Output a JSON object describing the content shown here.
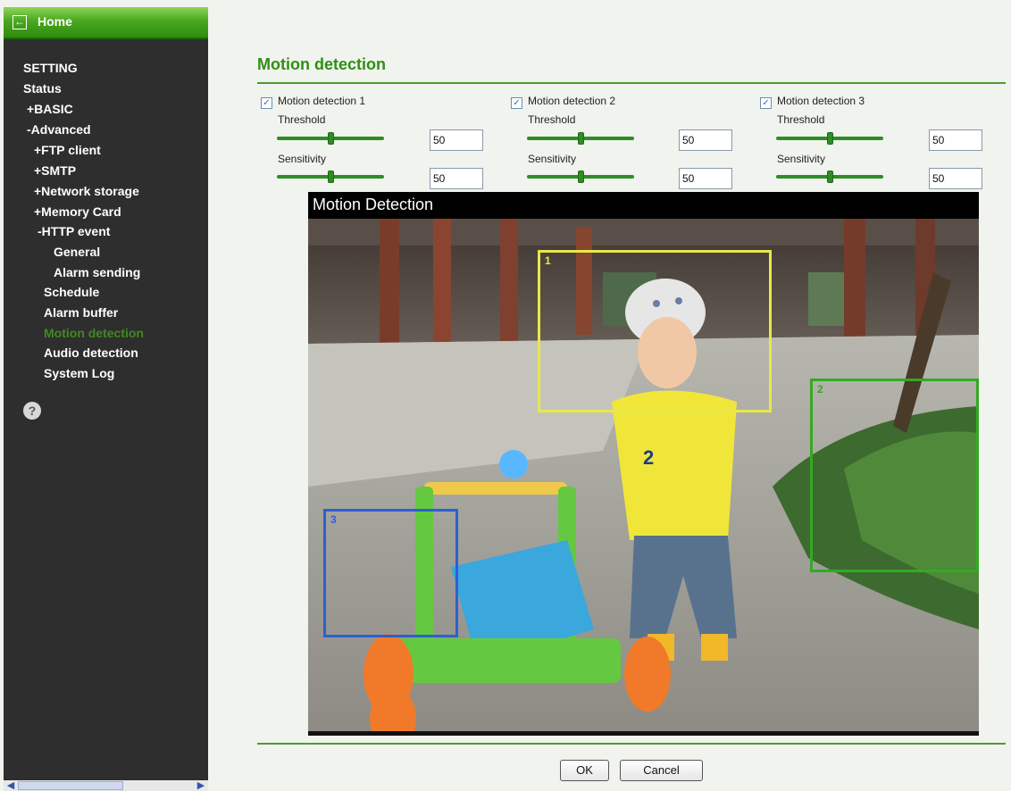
{
  "sidebar": {
    "home_label": "Home",
    "items": [
      {
        "label": "SETTING"
      },
      {
        "label": "Status"
      },
      {
        "label": "+BASIC"
      },
      {
        "label": "-Advanced"
      },
      {
        "label": "+FTP client"
      },
      {
        "label": "+SMTP"
      },
      {
        "label": "+Network storage"
      },
      {
        "label": "+Memory Card"
      },
      {
        "label": "-HTTP event"
      },
      {
        "label": "General"
      },
      {
        "label": "Alarm sending"
      },
      {
        "label": "Schedule"
      },
      {
        "label": "Alarm buffer"
      },
      {
        "label": "Motion detection"
      },
      {
        "label": "Audio detection"
      },
      {
        "label": "System Log"
      }
    ],
    "help_glyph": "?"
  },
  "page": {
    "title": "Motion detection"
  },
  "groups": [
    {
      "label": "Motion detection 1",
      "checked": true,
      "threshold_label": "Threshold",
      "threshold_value": "50",
      "sensitivity_label": "Sensitivity",
      "sensitivity_value": "50"
    },
    {
      "label": "Motion detection 2",
      "checked": true,
      "threshold_label": "Threshold",
      "threshold_value": "50",
      "sensitivity_label": "Sensitivity",
      "sensitivity_value": "50"
    },
    {
      "label": "Motion detection 3",
      "checked": true,
      "threshold_label": "Threshold",
      "threshold_value": "50",
      "sensitivity_label": "Sensitivity",
      "sensitivity_value": "50"
    }
  ],
  "viewer": {
    "title": "Motion Detection",
    "regions": [
      {
        "label": "1",
        "color": "#e8e84a"
      },
      {
        "label": "2",
        "color": "#33aa22"
      },
      {
        "label": "3",
        "color": "#2d5fd4"
      }
    ]
  },
  "buttons": {
    "ok": "OK",
    "cancel": "Cancel"
  },
  "colors": {
    "accent_green": "#2f8f12",
    "sidebar_bg": "#2e2e2e",
    "active_item": "#3f8a1e"
  }
}
